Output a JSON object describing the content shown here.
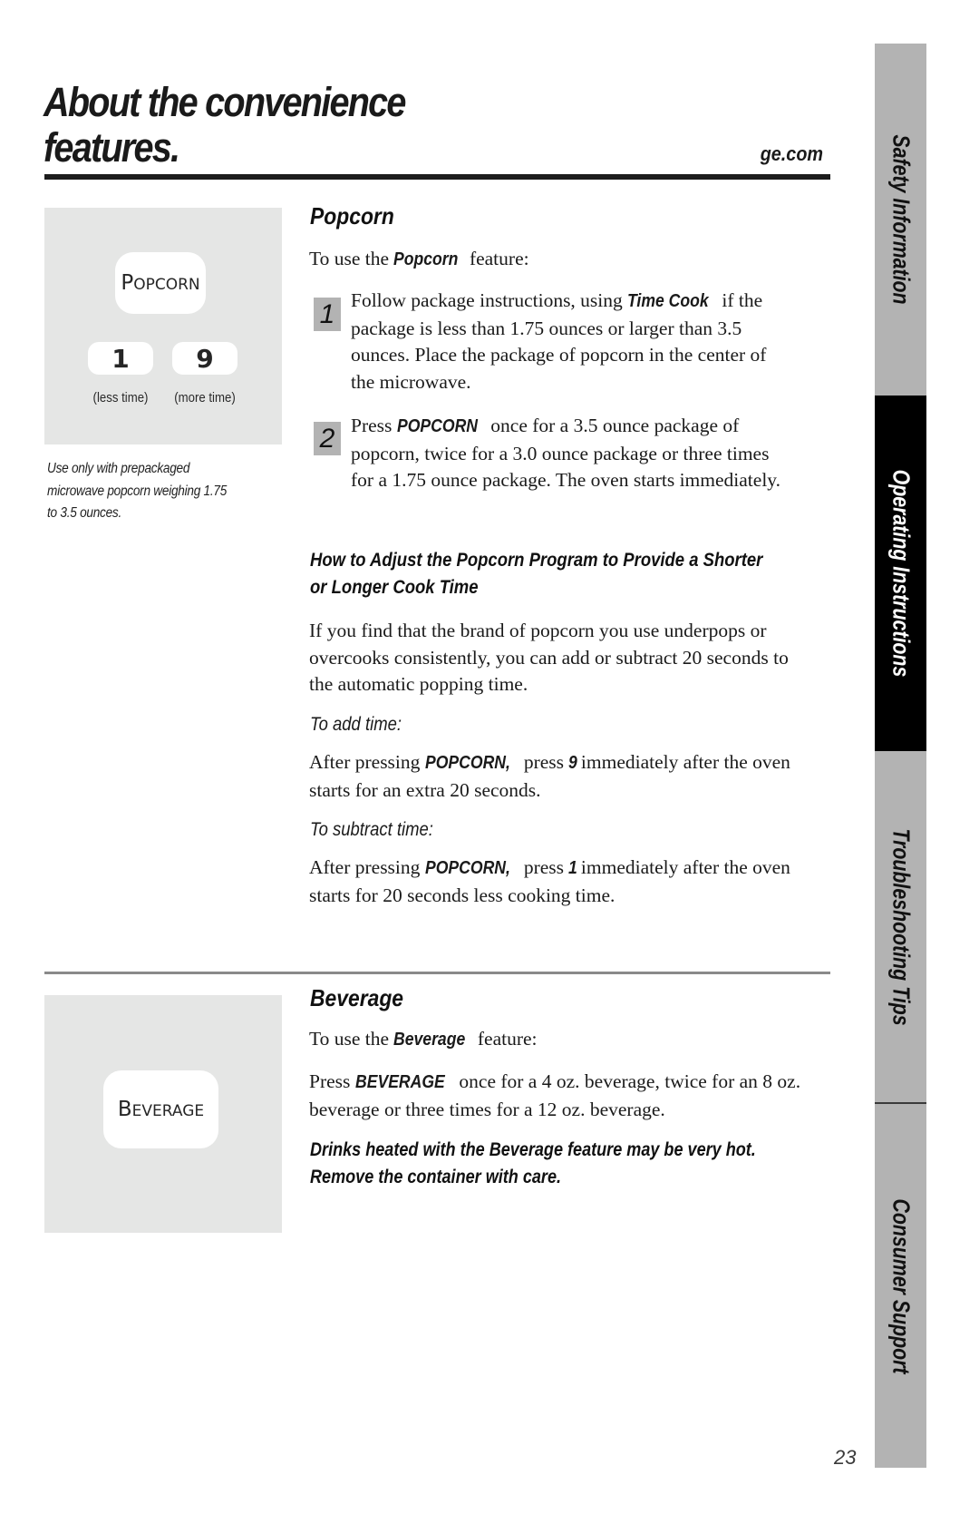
{
  "header": {
    "title_line1": "About the convenience",
    "title_line2": "features.",
    "site": "ge.com"
  },
  "popcorn_panel": {
    "main_key": "Popcorn",
    "key_less": "1",
    "key_more": "9",
    "caption_less": "(less time)",
    "caption_more": "(more time)",
    "note": "Use only with prepackaged microwave popcorn weighing 1.75 to 3.5 ounces."
  },
  "popcorn": {
    "heading": "Popcorn",
    "intro_prefix": "To use the",
    "intro_em": "Popcorn",
    "intro_suffix": " feature:",
    "steps": [
      {
        "number": "1",
        "prefix": "Follow package instructions, using ",
        "em": "Time Cook",
        "suffix": " if the package is less than 1.75 ounces or larger than 3.5 ounces. Place the package of popcorn in the center of the microwave."
      },
      {
        "number": "2",
        "prefix": "Press ",
        "em": "POPCORN",
        "suffix": " once for a 3.5 ounce package of popcorn, twice for a 3.0 ounce package or three times for a 1.75 ounce package. The oven starts immediately."
      }
    ],
    "adjust_heading": "How to Adjust the Popcorn Program to Provide a Shorter or Longer Cook Time",
    "adjust_body": "If you find that the brand of popcorn you use underpops or overcooks consistently, you can add or subtract 20 seconds to the automatic popping time.",
    "add_label": "To add time:",
    "add_body": {
      "prefix": "After pressing ",
      "em1": "POPCORN,",
      "middle": " press ",
      "em2": "9",
      "suffix": " immediately after the oven starts for an extra 20 seconds."
    },
    "subtract_label": "To subtract time:",
    "subtract_body": {
      "prefix": "After pressing ",
      "em1": "POPCORN,",
      "middle": " press ",
      "em2": "1",
      "suffix": " immediately after the oven starts for 20 seconds less cooking time."
    }
  },
  "beverage_panel": {
    "main_key": "Beverage"
  },
  "beverage": {
    "heading": "Beverage",
    "intro_prefix": "To use the",
    "intro_em": "Beverage",
    "intro_suffix": " feature:",
    "body_prefix": "Press ",
    "body_em": "BEVERAGE",
    "body_suffix": " once for a 4 oz. beverage, twice for an 8 oz. beverage or three times for a 12 oz. beverage.",
    "warning": "Drinks heated with the Beverage feature may be very hot. Remove the container with care."
  },
  "side_tabs": [
    {
      "label": "Safety Information",
      "active": false
    },
    {
      "label": "Operating Instructions",
      "active": true
    },
    {
      "label": "Troubleshooting Tips",
      "active": false
    },
    {
      "label": "Consumer Support",
      "active": false
    }
  ],
  "page_number": "23",
  "colors": {
    "panel_bg": "#e5e6e5",
    "tab_bg": "#b3b3b3",
    "tab_active_bg": "#000000",
    "step_badge_bg": "#b3b3b3"
  }
}
